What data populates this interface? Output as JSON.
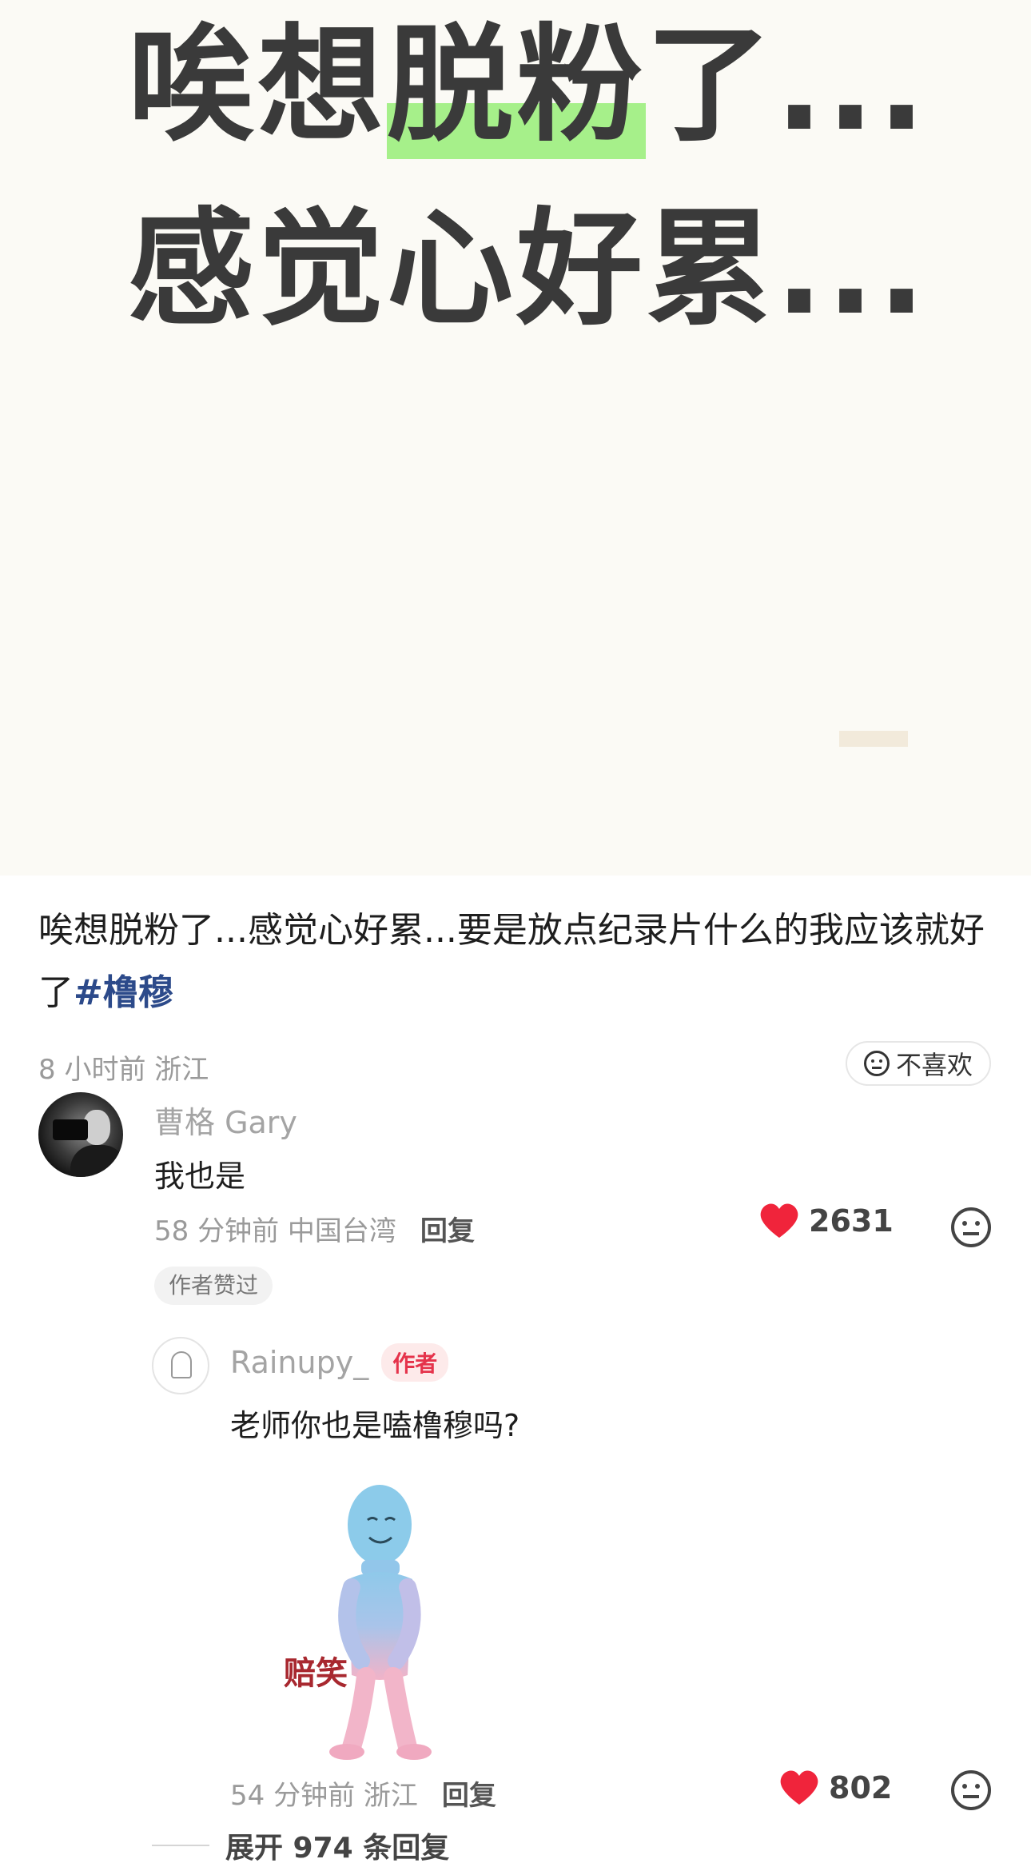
{
  "cover": {
    "line1_pre": "唉想",
    "line1_highlight": "脱粉",
    "line1_post": "了...",
    "line2": "感觉心好累...",
    "highlight_color": "#a6f08a"
  },
  "post": {
    "text": "唉想脱粉了...感觉心好累...要是放点纪录片什么的我应该就好了",
    "hashtag": "#橹穆",
    "meta": "8 小时前 浙江",
    "dislike_label": "不喜欢"
  },
  "comment": {
    "user": "曹格 Gary",
    "text": "我也是",
    "meta": "58 分钟前 中国台湾",
    "reply_label": "回复",
    "likes": "2631",
    "author_liked": "作者赞过"
  },
  "reply": {
    "user": "Rainupy_",
    "badge": "作者",
    "text": "老师你也是嗑橹穆吗?",
    "sticker_caption": "赔笑",
    "meta": "54 分钟前 浙江",
    "reply_label": "回复",
    "likes": "802"
  },
  "expand": {
    "label": "展开 974 条回复"
  },
  "colors": {
    "heart": "#f0243b",
    "hashtag": "#2c4a8a",
    "author_badge": "#e5334b"
  }
}
